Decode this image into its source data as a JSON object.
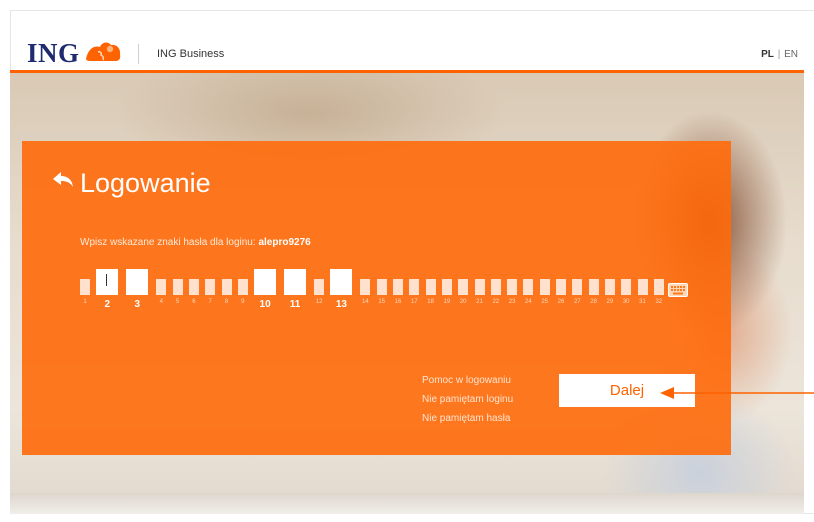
{
  "header": {
    "logo_text": "ING",
    "product": "ING Business",
    "lang_active": "PL",
    "lang_separator": "|",
    "lang_other": "EN"
  },
  "login": {
    "title": "Logowanie",
    "instruction": "Wpisz wskazane znaki hasła dla loginu: ",
    "username": "alepro9276",
    "password_positions": [
      "1",
      "2",
      "3",
      "4",
      "5",
      "6",
      "7",
      "8",
      "9",
      "10",
      "11",
      "12",
      "13",
      "14",
      "15",
      "16",
      "17",
      "18",
      "19",
      "20",
      "21",
      "22",
      "23",
      "24",
      "25",
      "26",
      "27",
      "28",
      "29",
      "30",
      "31",
      "32"
    ],
    "active_positions": [
      2,
      3,
      10,
      11,
      13
    ],
    "help_links": [
      "Pomoc w logowaniu",
      "Nie pamiętam loginu",
      "Nie pamiętam hasła"
    ],
    "submit_label": "Dalej"
  },
  "colors": {
    "brand_orange": "#ff6200",
    "brand_navy": "#1f2b6e"
  },
  "icons": {
    "back": "back-arrow-icon",
    "keyboard": "keyboard-icon",
    "logo": "lion-logo-icon"
  }
}
